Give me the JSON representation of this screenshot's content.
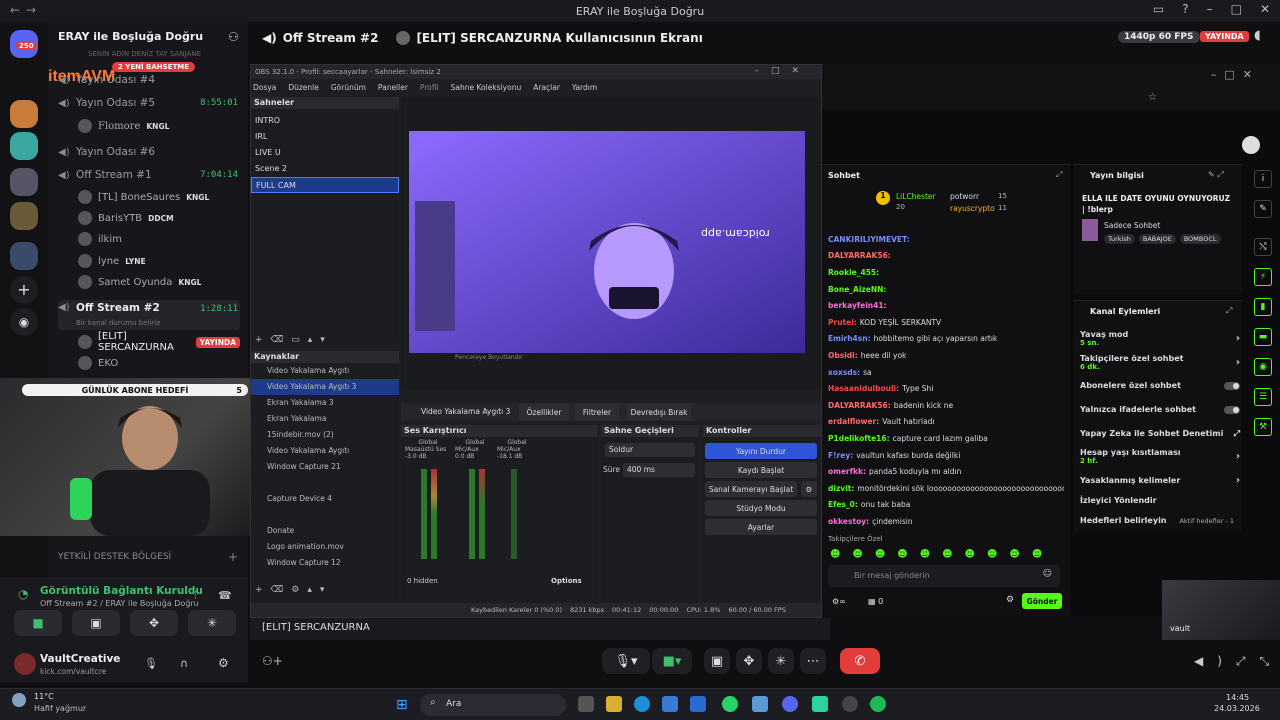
{
  "window_title": "ERAY ile Boşluğa Doğru",
  "server_badge": "250",
  "channel_list": {
    "server_name": "ERAY ile Boşluğa Doğru",
    "scroll_text": "SENİN ADIN DENİZ TAY SANJANE",
    "overlay_logo": "itemAVM",
    "overlay_banner": "2 YENİ BAHSETME",
    "channels": [
      {
        "name": "Yayın Odası #4",
        "time": ""
      },
      {
        "name": "Yayın Odası #5",
        "time": "8:55:01"
      },
      {
        "name": "Yayın Odası #6",
        "time": ""
      },
      {
        "name": "Off Stream #1",
        "time": "7:04:14"
      },
      {
        "name": "Off Stream #2",
        "time": "1:28:11",
        "status": "Bir kanal durumu belirle"
      }
    ],
    "users_room5": [
      {
        "name": "Flomore",
        "tag": "KNGL"
      }
    ],
    "users_off1": [
      {
        "name": "[TL] BoneSaures",
        "tag": "KNGL"
      },
      {
        "name": "BarisYTB",
        "tag": "DDCM"
      },
      {
        "name": "ilkim",
        "tag": ""
      },
      {
        "name": "lyne",
        "tag": "LYNE"
      },
      {
        "name": "Samet Oyunda",
        "tag": "KNGL"
      }
    ],
    "users_off2": [
      {
        "name": "[ELIT] SERCANZURNA",
        "live": "YAYINDA"
      },
      {
        "name": "EKO",
        "live": ""
      }
    ],
    "support_category": "YETKİLİ DESTEK BÖLGESİ",
    "goal_label": "GÜNLÜK ABONE HEDEFİ",
    "goal_value": "5"
  },
  "voice_panel": {
    "status": "Görüntülü Bağlantı Kuruldu",
    "location": "Off Stream #2 / ERAY ile Boşluğa Doğru",
    "user": "VaultCreative",
    "user_sub": "kick.com/vaultcre"
  },
  "stream_header": {
    "channel": "Off Stream #2",
    "title": "[ELIT] SERCANZURNA Kullanıcısının Ekranı",
    "quality": "1440p 60 FPS",
    "live": "YAYINDA"
  },
  "obs": {
    "title": "OBS 32.1.0 - Profil: seccaayarlar - Sahneler: İsimsiz 2",
    "menu": [
      "Dosya",
      "Düzenle",
      "Görünüm",
      "Paneller",
      "Profil",
      "Sahne Koleksiyonu",
      "Araçlar",
      "Yardım"
    ],
    "scenes_label": "Sahneler",
    "scenes": [
      "INTRO",
      "IRL",
      "LIVE U",
      "Scene 2",
      "FULL CAM"
    ],
    "sources_label": "Kaynaklar",
    "sources": [
      "Video Yakalama Aygıtı",
      "Video Yakalama Aygıtı 3",
      "Ekran Yakalama 3",
      "Ekran Yakalama",
      "15indebir.mov (2)",
      "Video Yakalama Aygıtı",
      "Window Capture 21",
      "",
      "Capture Device 4",
      "",
      "Donate",
      "Logo animation.mov",
      "Window Capture 12",
      "Window Capture 12"
    ],
    "preview_watermark": "roidcam.app",
    "under_preview": "Pencereye Boyutlandır",
    "selected_source": "Video Yakalama Aygıtı 3",
    "btn_properties": "Özellikler",
    "btn_filters": "Filtreler",
    "btn_deactivate": "Devredışı Bırak",
    "mixer_label": "Ses Karıştırıcı",
    "mixer_channels": [
      {
        "scope": "Global",
        "name": "Masaüstü Ses",
        "db": "-3.0 dB"
      },
      {
        "scope": "Global",
        "name": "Mic/Aux",
        "db": "0.0 dB"
      },
      {
        "scope": "Global",
        "name": "Mic/Aux",
        "db": "-18.1 dB"
      }
    ],
    "hidden": "0 hidden",
    "options": "Options",
    "transitions_label": "Sahne Geçişleri",
    "transition": "Soldur",
    "duration_label": "Süre",
    "duration": "400 ms",
    "controls_label": "Kontroller",
    "controls": [
      "Yayını Durdur",
      "Kaydı Başlat",
      "Sanal Kamerayı Başlat",
      "Stüdyo Modu",
      "Ayarlar"
    ],
    "status_bar": {
      "dropped": "Kaybedilen Kareler 0 (%0.0)",
      "kbps": "8231 kbps",
      "live_time": "00:41:12",
      "rec_time": "00:00:00",
      "cpu": "CPU: 1.8%",
      "fps": "60.00 / 60.00 FPS"
    }
  },
  "kick": {
    "chat_title": "Sohbet",
    "top_gifters": [
      {
        "name": "LiLChester",
        "count": "20"
      },
      {
        "name": "potworr",
        "count": "15"
      },
      {
        "name": "rayuscrypto",
        "count": "11"
      }
    ],
    "chat": [
      {
        "user": "CANKIRILIYIMEVET:",
        "msg": "",
        "color": "#7b8cff"
      },
      {
        "user": "DALYARRAK56:",
        "msg": "",
        "color": "#ff6b6b"
      },
      {
        "user": "Rookie_455:",
        "msg": "",
        "color": "#53fc18"
      },
      {
        "user": "Bone_AizeNN:",
        "msg": "",
        "color": "#53fc18"
      },
      {
        "user": "berkayfein41:",
        "msg": "",
        "color": "#ff6bd6"
      },
      {
        "user": "Prutel:",
        "msg": "KOD YEŞİL SERKANTV",
        "color": "#ff4444"
      },
      {
        "user": "Emirh4sn:",
        "msg": "hobbitemo gibi açı yaparsın artık",
        "color": "#7b8cff"
      },
      {
        "user": "Obsidi:",
        "msg": "heee dil yok",
        "color": "#ff6b6b"
      },
      {
        "user": "xoxsds:",
        "msg": "sa",
        "color": "#7b8cff"
      },
      {
        "user": "Hasaanidulbouli:",
        "msg": "Type Shi",
        "color": "#ff4444"
      },
      {
        "user": "DALYARRAK56:",
        "msg": "badenin kick ne",
        "color": "#ff6b6b"
      },
      {
        "user": "erdalflower:",
        "msg": "Vault hatırladı",
        "color": "#ff6b6b"
      },
      {
        "user": "P1delikofte16:",
        "msg": "capture card lazım galiba",
        "color": "#53fc18"
      },
      {
        "user": "F!rey:",
        "msg": "vaultun kafası burda değilki",
        "color": "#7b8cff"
      },
      {
        "user": "omerfkk:",
        "msg": "panda5 koduyla mı aldın",
        "color": "#ff6bd6"
      },
      {
        "user": "dizvit:",
        "msg": "monitördekini sök looooooooooooooooooooooooooooooo",
        "color": "#53fc18"
      },
      {
        "user": "Efes_0:",
        "msg": "onu tak baba",
        "color": "#53fc18"
      },
      {
        "user": "okkestoy:",
        "msg": "çindemisin",
        "color": "#ff6bd6"
      }
    ],
    "emote_label": "Takipçilere Özel",
    "chat_placeholder": "Bir mesaj gönderin",
    "send_btn": "Gönder",
    "viewer_count": "0",
    "stream_info_title": "Yayın bilgisi",
    "stream_title": "ELLA ILE DATE OYUNU OYNUYORUZ | !blerp",
    "category": "Sadece Sohbet",
    "tags": [
      "Turkish",
      "BABAJOE",
      "BOMBOCL"
    ],
    "actions_title": "Kanal Eylemleri",
    "actions": [
      {
        "label": "Yavaş mod",
        "sub": "5 sn."
      },
      {
        "label": "Takipçilere özel sohbet",
        "sub": "6 dk."
      },
      {
        "label": "Abonelere özel sohbet",
        "sub": ""
      },
      {
        "label": "Yalnızca ifadelerle sohbet",
        "sub": ""
      },
      {
        "label": "Yapay Zeka ile Sohbet Denetimi",
        "sub": ""
      },
      {
        "label": "Hesap yaşı kısıtlaması",
        "sub": "2 hf."
      },
      {
        "label": "Yasaklanmış kelimeler",
        "sub": ""
      },
      {
        "label": "İzleyici Yönlendir",
        "sub": ""
      },
      {
        "label": "Hedefleri belirleyin",
        "sub": "Aktif hedefler - 1"
      }
    ]
  },
  "taskbar": {
    "active_window": "[ELIT] SERCANZURNA",
    "search": "Ara",
    "weather_temp": "11°C",
    "weather_desc": "Hafif yağmur",
    "time": "14:45",
    "date": "24.03.2026",
    "pip_label": "vault"
  },
  "colors": {
    "accent_green": "#53fc18",
    "live_red": "#e23c3c",
    "discord_green": "#3fbf6f"
  }
}
